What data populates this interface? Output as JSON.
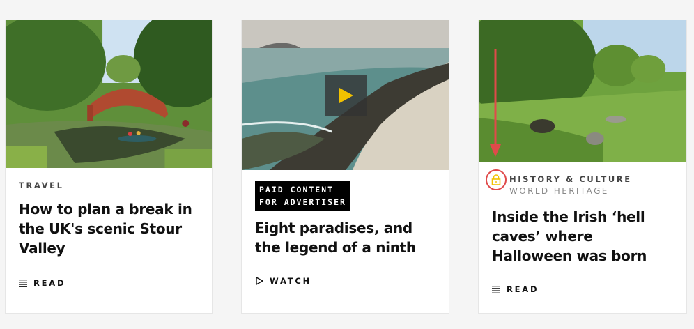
{
  "cards": [
    {
      "category": "TRAVEL",
      "title": "How to plan a break in the UK's scenic Stour Valley",
      "action_label": "READ",
      "action_icon": "list-icon"
    },
    {
      "paid_line1": "PAID CONTENT",
      "paid_line2": "FOR ADVERTISER",
      "title": "Eight paradises, and the legend of a ninth",
      "action_label": "WATCH",
      "action_icon": "play-outline-icon",
      "video_icon": "play-icon"
    },
    {
      "category": "HISTORY & CULTURE",
      "subcategory": "WORLD HERITAGE",
      "title": "Inside the Irish ‘hell caves’ where Halloween was born",
      "action_label": "READ",
      "action_icon": "list-icon",
      "premium_icon": "lock-icon"
    }
  ],
  "colors": {
    "play_yellow": "#f2c200",
    "lock_yellow": "#f2c200",
    "annotation_red": "#e04a4a"
  }
}
